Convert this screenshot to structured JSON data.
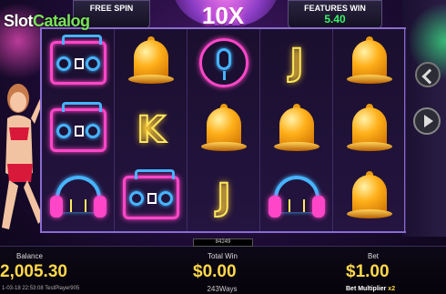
{
  "logo": {
    "part1": "Slot",
    "part2": "Catalog"
  },
  "top": {
    "free_spin_label": "FREE SPIN",
    "free_spin_value": "",
    "multiplier": "10X",
    "features_win_label": "FEATURES WIN",
    "features_win_value": "5.40"
  },
  "reels": [
    [
      "boombox",
      "boombox",
      "headphones"
    ],
    [
      "bell",
      "K",
      "boombox"
    ],
    [
      "microphone",
      "bell",
      "J"
    ],
    [
      "J",
      "bell",
      "headphones"
    ],
    [
      "bell",
      "bell",
      "bell"
    ]
  ],
  "bottom": {
    "balance_label": "Balance",
    "balance_value": "2,005.30",
    "total_win_label": "Total Win",
    "total_win_value": "$0.00",
    "bet_label": "Bet",
    "bet_value": "$1.00",
    "ways": "243Ways",
    "ticket": "84249",
    "footer": "1-03-18 22:53:08  TestPlayer905",
    "bet_multiplier_label": "Bet Multiplier",
    "bet_multiplier_value": "x2"
  },
  "colors": {
    "accent_pink": "#ff46c8",
    "accent_blue": "#46b4ff",
    "win_green": "#3df26a",
    "gold": "#ffd84a"
  }
}
